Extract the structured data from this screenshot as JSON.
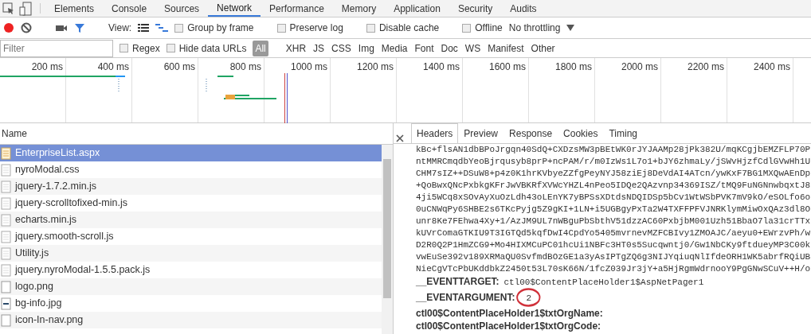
{
  "main_tabs": [
    {
      "label": "Elements",
      "selected": false
    },
    {
      "label": "Console",
      "selected": false
    },
    {
      "label": "Sources",
      "selected": false
    },
    {
      "label": "Network",
      "selected": true
    },
    {
      "label": "Performance",
      "selected": false
    },
    {
      "label": "Memory",
      "selected": false
    },
    {
      "label": "Application",
      "selected": false
    },
    {
      "label": "Security",
      "selected": false
    },
    {
      "label": "Audits",
      "selected": false
    }
  ],
  "toolbar": {
    "recording": true,
    "view_label": "View:",
    "checkboxes": [
      {
        "label": "Group by frame",
        "checked": false
      },
      {
        "label": "Preserve log",
        "checked": false
      },
      {
        "label": "Disable cache",
        "checked": false
      },
      {
        "label": "Offline",
        "checked": false
      }
    ],
    "throttling": "No throttling"
  },
  "filter_bar": {
    "placeholder": "Filter",
    "checkboxes": [
      {
        "label": "Regex",
        "checked": false
      },
      {
        "label": "Hide data URLs",
        "checked": false
      }
    ],
    "types": [
      {
        "label": "All",
        "selected": true
      },
      {
        "label": "XHR",
        "selected": false
      },
      {
        "label": "JS",
        "selected": false
      },
      {
        "label": "CSS",
        "selected": false
      },
      {
        "label": "Img",
        "selected": false
      },
      {
        "label": "Media",
        "selected": false
      },
      {
        "label": "Font",
        "selected": false
      },
      {
        "label": "Doc",
        "selected": false
      },
      {
        "label": "WS",
        "selected": false
      },
      {
        "label": "Manifest",
        "selected": false
      },
      {
        "label": "Other",
        "selected": false
      }
    ]
  },
  "timeline": {
    "ticks": [
      "200 ms",
      "400 ms",
      "600 ms",
      "800 ms",
      "1000 ms",
      "1200 ms",
      "1400 ms",
      "1600 ms",
      "1800 ms",
      "2000 ms",
      "2200 ms",
      "2400 ms"
    ]
  },
  "requests": {
    "column": "Name",
    "rows": [
      {
        "name": "EnterpriseList.aspx",
        "kind": "document",
        "selected": true
      },
      {
        "name": "nyroModal.css",
        "kind": "file",
        "selected": false
      },
      {
        "name": "jquery-1.7.2.min.js",
        "kind": "file",
        "selected": false
      },
      {
        "name": "jquery-scrolltofixed-min.js",
        "kind": "file",
        "selected": false
      },
      {
        "name": "echarts.min.js",
        "kind": "file",
        "selected": false
      },
      {
        "name": "jquery.smooth-scroll.js",
        "kind": "file",
        "selected": false
      },
      {
        "name": "Utility.js",
        "kind": "file",
        "selected": false
      },
      {
        "name": "jquery.nyroModal-1.5.5.pack.js",
        "kind": "file",
        "selected": false
      },
      {
        "name": "logo.png",
        "kind": "image",
        "selected": false
      },
      {
        "name": "bg-info.jpg",
        "kind": "photo",
        "selected": false
      },
      {
        "name": "icon-In-nav.png",
        "kind": "image",
        "selected": false
      }
    ]
  },
  "details": {
    "tabs": [
      {
        "label": "Headers",
        "selected": true
      },
      {
        "label": "Preview",
        "selected": false
      },
      {
        "label": "Response",
        "selected": false
      },
      {
        "label": "Cookies",
        "selected": false
      },
      {
        "label": "Timing",
        "selected": false
      }
    ],
    "lines": [
      {
        "kind": "value",
        "text": "kBc+flsAN1dbBPoJrgqn40SdQ+CXDzsMW3pBEtWK0rJYJAAMp28jPk382U/mqKCgjbEMZFLP70P"
      },
      {
        "kind": "value",
        "text": "ntMMRCmqdbYeoBjrqusyb8prP+ncPAM/r/m0IzWs1L7o1+bJY6zhmaLy/jSWvHjzfCdlGVwHh1U"
      },
      {
        "kind": "value",
        "text": "CHM7sIZ++DSuW8+p4z0K1hrKVbyeZZfgPeyNYJ58ziEj8DeVdAI4ATcn/ywKxF7BG1MXQwAEnDp"
      },
      {
        "kind": "value",
        "text": "+QoBwxQNcPxbkgKFrJwVBKRfXVWcYHZL4nPeo5IDQe2QAzvnp34369ISZ/tMQ9FuNGNnwbqxtJ8"
      },
      {
        "kind": "value",
        "text": "4ji5WCq8xSOvAyXuOzLdh43oLEnYK7yBPSsXDtdsNDQIDSp5bCv1WtWSbPVK7mV9kO/eSOLfo6o"
      },
      {
        "kind": "value",
        "text": "0uCNWqPy6SHBE2s6TKcPyjg5Z9gKI+1LN+i5UGBgyPxTa2W4TXFFPFVJNRKlymMiwOxQAz3dl8O"
      },
      {
        "kind": "value",
        "text": "unr8Ke7FEhwa4Xy+1/AzJM9UL7nWBguPbSbthV51dzzAC60PxbjbM001Uzh51BbaO7la31crTTx"
      },
      {
        "kind": "value",
        "text": "kUVrComaGTKIU9T3IGTQd5kqfDwI4CpdYo5405mvrnevMZFCBIvy1ZMOAJC/aeyu0+EWrzvPh/w"
      },
      {
        "kind": "value",
        "text": "D2R0Q2P1HmZCG9+Mo4HIXMCuPC01hcUi1NBFc3HT0s5Sucqwntj0/Gw1NbCKy9ftdueyMP3C00k"
      },
      {
        "kind": "value",
        "text": "vwEuSe392v189XRMaQU0SvfmdBOzGE1a3yAsIPTgZQ6g3NIJYqiuqNlIfdeORH1WK5abrfRQiUB"
      },
      {
        "kind": "value",
        "text": "NieCgVTcPbUKddbkZ2450t53L70sK66N/1fcZ039Jr3jY+a5HjRgmWdrnooY9PgGNwSCuV++H/o"
      },
      {
        "kind": "field",
        "key": "__EVENTTARGET:",
        "value": "ctl00$ContentPlaceHolder1$AspNetPager1"
      },
      {
        "kind": "field",
        "key": "__EVENTARGUMENT:",
        "value": "2",
        "circled": true
      },
      {
        "kind": "field",
        "key": "ctl00$ContentPlaceHolder1$txtOrgName:"
      },
      {
        "kind": "field",
        "key": "ctl00$ContentPlaceHolder1$txtOrgCode:"
      }
    ]
  }
}
